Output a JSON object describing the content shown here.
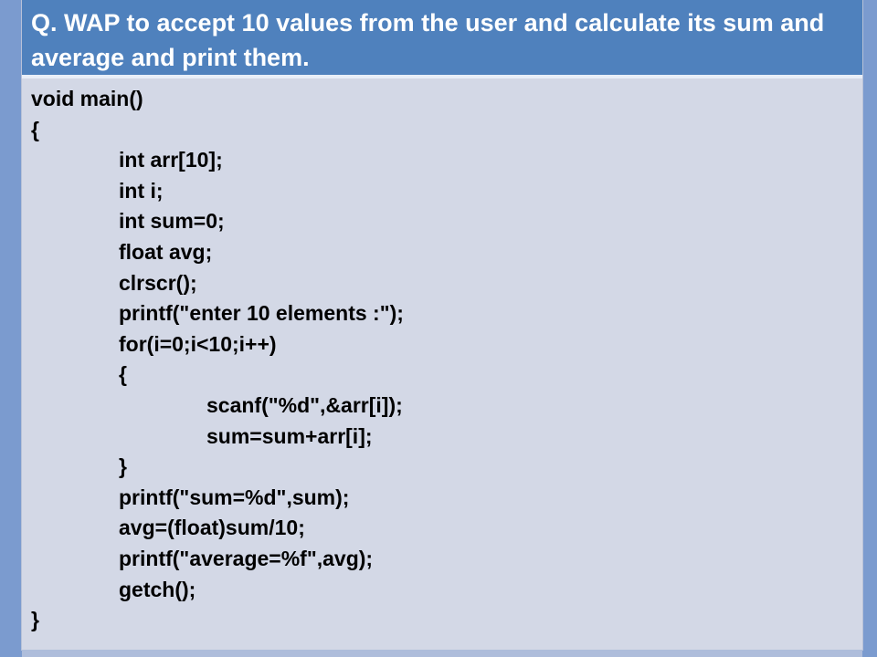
{
  "question": {
    "text": "Q. WAP to accept 10 values from the user and calculate its sum and average and print them."
  },
  "code": {
    "lines": [
      {
        "text": "void main()",
        "indent": 0
      },
      {
        "text": "{",
        "indent": 0
      },
      {
        "text": "int arr[10];",
        "indent": 1
      },
      {
        "text": "int i;",
        "indent": 1
      },
      {
        "text": "int sum=0;",
        "indent": 1
      },
      {
        "text": "float avg;",
        "indent": 1
      },
      {
        "text": "clrscr();",
        "indent": 1
      },
      {
        "text": "printf(\"enter 10 elements :\");",
        "indent": 1
      },
      {
        "text": "for(i=0;i<10;i++)",
        "indent": 1
      },
      {
        "text": "{",
        "indent": 1
      },
      {
        "text": "scanf(\"%d\",&arr[i]);",
        "indent": 2
      },
      {
        "text": "sum=sum+arr[i];",
        "indent": 2
      },
      {
        "text": "}",
        "indent": 1
      },
      {
        "text": "printf(\"sum=%d\",sum);",
        "indent": 1
      },
      {
        "text": "avg=(float)sum/10;",
        "indent": 1
      },
      {
        "text": "printf(\"average=%f\",avg);",
        "indent": 1
      },
      {
        "text": "getch();",
        "indent": 1
      },
      {
        "text": "}",
        "indent": 0
      }
    ]
  }
}
